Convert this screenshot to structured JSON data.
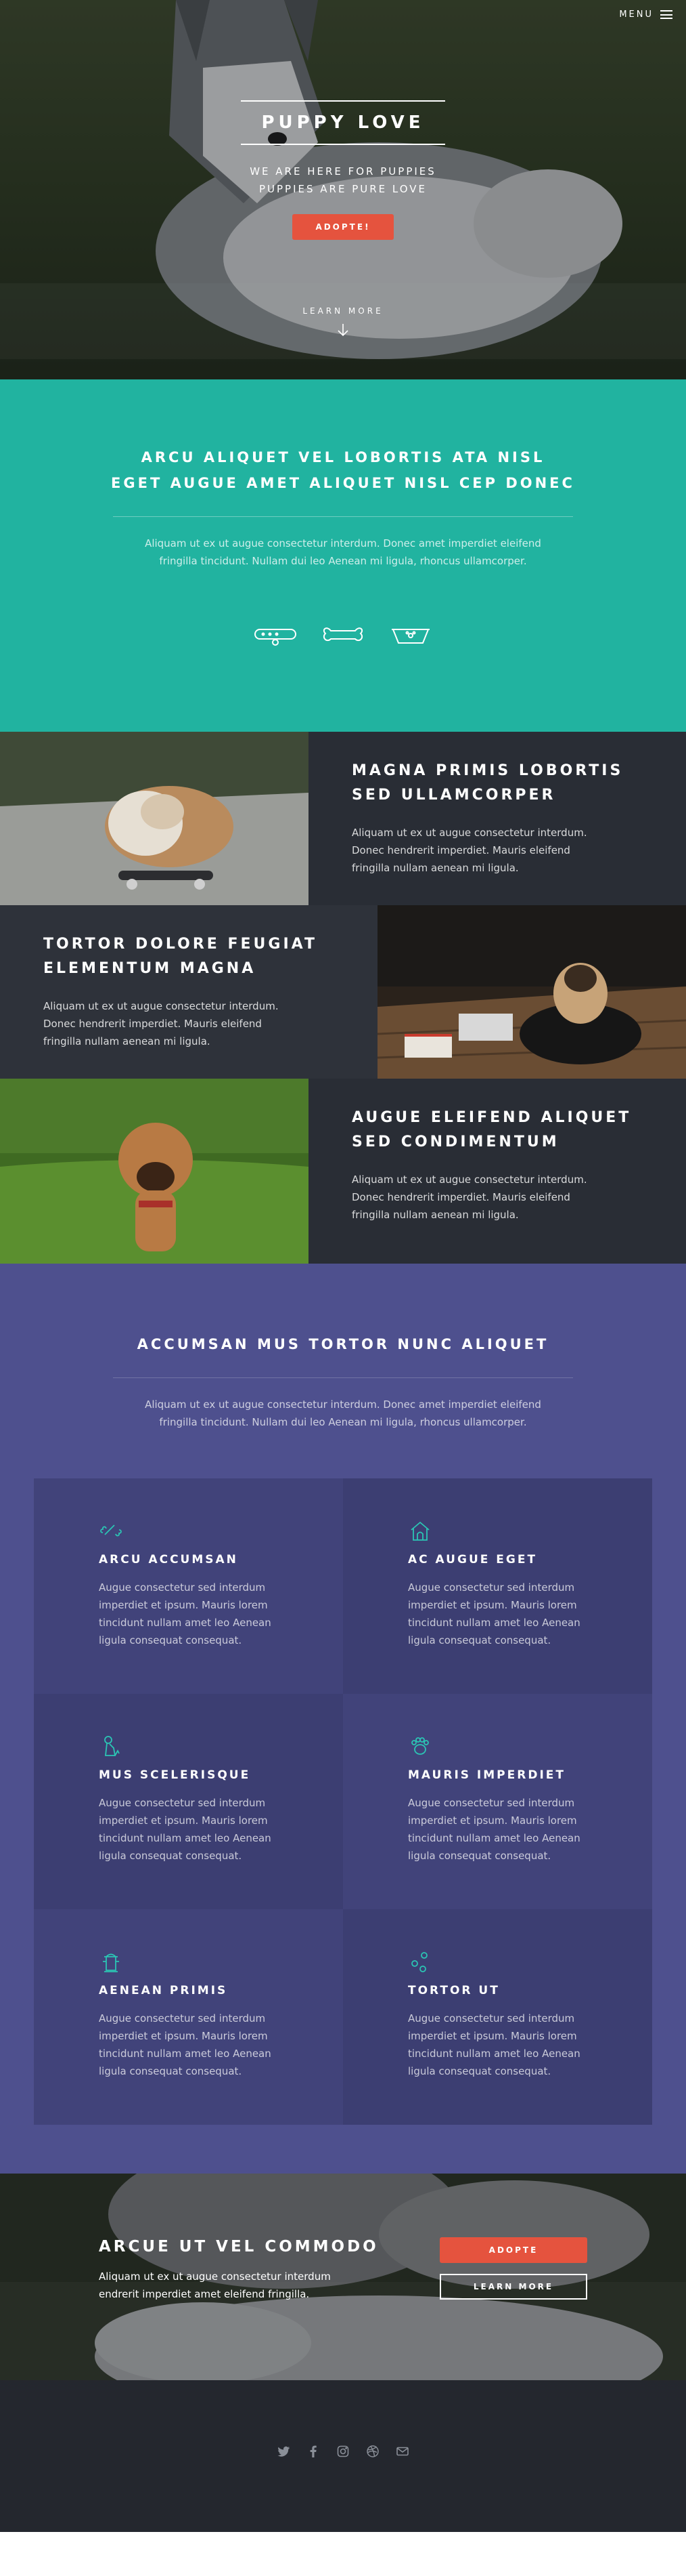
{
  "header": {
    "menu_label": "MENU",
    "menu_icon": "hamburger-icon"
  },
  "hero": {
    "title": "PUPPY LOVE",
    "subtitle_line1": "WE ARE HERE FOR PUPPIES",
    "subtitle_line2": "PUPPIES ARE PURE LOVE",
    "cta_label": "ADOPTE!",
    "learn_more": "LEARN MORE",
    "learn_more_icon": "arrow-down-icon"
  },
  "intro": {
    "title_line1": "ARCU ALIQUET VEL LOBORTIS ATA NISL",
    "title_line2": "EGET AUGUE AMET ALIQUET NISL CEP DONEC",
    "text_line1": "Aliquam ut ex ut augue consectetur interdum. Donec amet imperdiet eleifend",
    "text_line2": "fringilla tincidunt. Nullam dui leo Aenean mi ligula, rhoncus ullamcorper.",
    "icons": [
      "collar-icon",
      "bone-icon",
      "dog-bowl-icon"
    ]
  },
  "spotlights": [
    {
      "title_line1": "MAGNA PRIMIS LOBORTIS",
      "title_line2": "SED ULLAMCORPER",
      "text_line1": "Aliquam ut ex ut augue consectetur interdum.",
      "text_line2": "Donec hendrerit imperdiet. Mauris eleifend",
      "text_line3": "fringilla nullam aenean mi ligula."
    },
    {
      "title_line1": "TORTOR DOLORE FEUGIAT",
      "title_line2": "ELEMENTUM MAGNA",
      "text_line1": "Aliquam ut ex ut augue consectetur interdum.",
      "text_line2": "Donec hendrerit imperdiet. Mauris eleifend",
      "text_line3": "fringilla nullam aenean mi ligula."
    },
    {
      "title_line1": "AUGUE ELEIFEND ALIQUET",
      "title_line2": "SED CONDIMENTUM",
      "text_line1": "Aliquam ut ex ut augue consectetur interdum.",
      "text_line2": "Donec hendrerit imperdiet. Mauris eleifend",
      "text_line3": "fringilla nullam aenean mi ligula."
    }
  ],
  "features": {
    "title": "ACCUMSAN MUS TORTOR NUNC ALIQUET",
    "text_line1": "Aliquam ut ex ut augue consectetur interdum. Donec amet imperdiet eleifend",
    "text_line2": "fringilla tincidunt. Nullam dui leo Aenean mi ligula, rhoncus ullamcorper.",
    "accent_color": "#2bc5b4",
    "items": [
      {
        "icon": "bone-icon",
        "title": "ARCU ACCUMSAN",
        "l1": "Augue consectetur sed interdum",
        "l2": "imperdiet et ipsum. Mauris lorem",
        "l3": "tincidunt nullam amet leo Aenean",
        "l4": "ligula consequat consequat."
      },
      {
        "icon": "dog-house-icon",
        "title": "AC AUGUE EGET",
        "l1": "Augue consectetur sed interdum",
        "l2": "imperdiet et ipsum. Mauris lorem",
        "l3": "tincidunt nullam amet leo Aenean",
        "l4": "ligula consequat consequat."
      },
      {
        "icon": "sitting-dog-icon",
        "title": "MUS SCELERISQUE",
        "l1": "Augue consectetur sed interdum",
        "l2": "imperdiet et ipsum. Mauris lorem",
        "l3": "tincidunt nullam amet leo Aenean",
        "l4": "ligula consequat consequat."
      },
      {
        "icon": "paw-hand-icon",
        "title": "MAURIS IMPERDIET",
        "l1": "Augue consectetur sed interdum",
        "l2": "imperdiet et ipsum. Mauris lorem",
        "l3": "tincidunt nullam amet leo Aenean",
        "l4": "ligula consequat consequat."
      },
      {
        "icon": "hydrant-icon",
        "title": "AENEAN PRIMIS",
        "l1": "Augue consectetur sed interdum",
        "l2": "imperdiet et ipsum. Mauris lorem",
        "l3": "tincidunt nullam amet leo Aenean",
        "l4": "ligula consequat consequat."
      },
      {
        "icon": "paw-prints-icon",
        "title": "TORTOR UT",
        "l1": "Augue consectetur sed interdum",
        "l2": "imperdiet et ipsum. Mauris lorem",
        "l3": "tincidunt nullam amet leo Aenean",
        "l4": "ligula consequat consequat."
      }
    ]
  },
  "cta": {
    "title": "ARCUE UT VEL COMMODO",
    "text_line1": "Aliquam ut ex ut augue consectetur interdum",
    "text_line2": "endrerit imperdiet amet eleifend fringilla.",
    "primary_label": "ADOPTE",
    "secondary_label": "LEARN MORE"
  },
  "footer": {
    "social_icons": [
      "twitter-icon",
      "facebook-icon",
      "instagram-icon",
      "dribbble-icon",
      "envelope-icon"
    ]
  },
  "colors": {
    "teal": "#21b3a0",
    "red": "#e5533e",
    "purple": "#4e508e",
    "dark": "#292d35",
    "footer": "#24272e"
  }
}
